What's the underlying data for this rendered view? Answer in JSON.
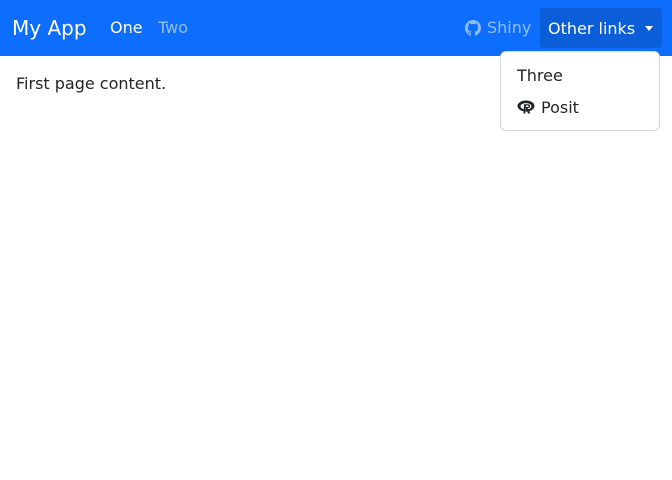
{
  "app": {
    "title": "My App"
  },
  "nav": {
    "items": [
      {
        "label": "One",
        "active": true
      },
      {
        "label": "Two",
        "active": false
      }
    ],
    "shiny": {
      "label": "Shiny",
      "icon": "github-icon"
    },
    "other_links": {
      "label": "Other links",
      "open": true,
      "items": [
        {
          "label": "Three"
        },
        {
          "label": "Posit",
          "icon": "r-project-icon"
        }
      ]
    }
  },
  "main": {
    "content": "First page content."
  },
  "colors": {
    "navbar_bg": "#0d6efd",
    "active_toggle_bg": "#0b5ed7",
    "text": "#212529"
  }
}
